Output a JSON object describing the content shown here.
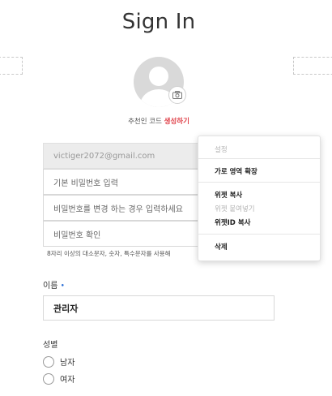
{
  "page": {
    "title": "Sign In"
  },
  "profile": {
    "referral_prefix": "추천인 코드 ",
    "referral_action": "생성하기",
    "camera_icon": "camera-icon"
  },
  "form": {
    "email_value": "victiger2072@gmail.com",
    "password_placeholder": "기본 비밀번호 입력",
    "new_password_placeholder": "비밀번호를 변경 하는 경우 입력하세요",
    "confirm_password_placeholder": "비밀번호 확인",
    "password_hint": "8자리 이상의 대소문자, 숫자, 특수문자를 사용해",
    "name_label": "이름",
    "name_required_marker": "•",
    "name_value": "관리자",
    "gender_label": "성별",
    "gender_options": [
      "남자",
      "여자"
    ]
  },
  "context_menu": {
    "header": "설정",
    "items": [
      "가로 영역 확장",
      "위젯 복사",
      "위젯 붙여넣기",
      "위젯ID 복사",
      "삭제"
    ],
    "disabled_items": [
      "설정",
      "위젯 붙여넣기"
    ]
  },
  "colors": {
    "accent_red": "#e0454d",
    "required_blue": "#2b6fd6",
    "avatar_gray": "#d9d9d9"
  }
}
